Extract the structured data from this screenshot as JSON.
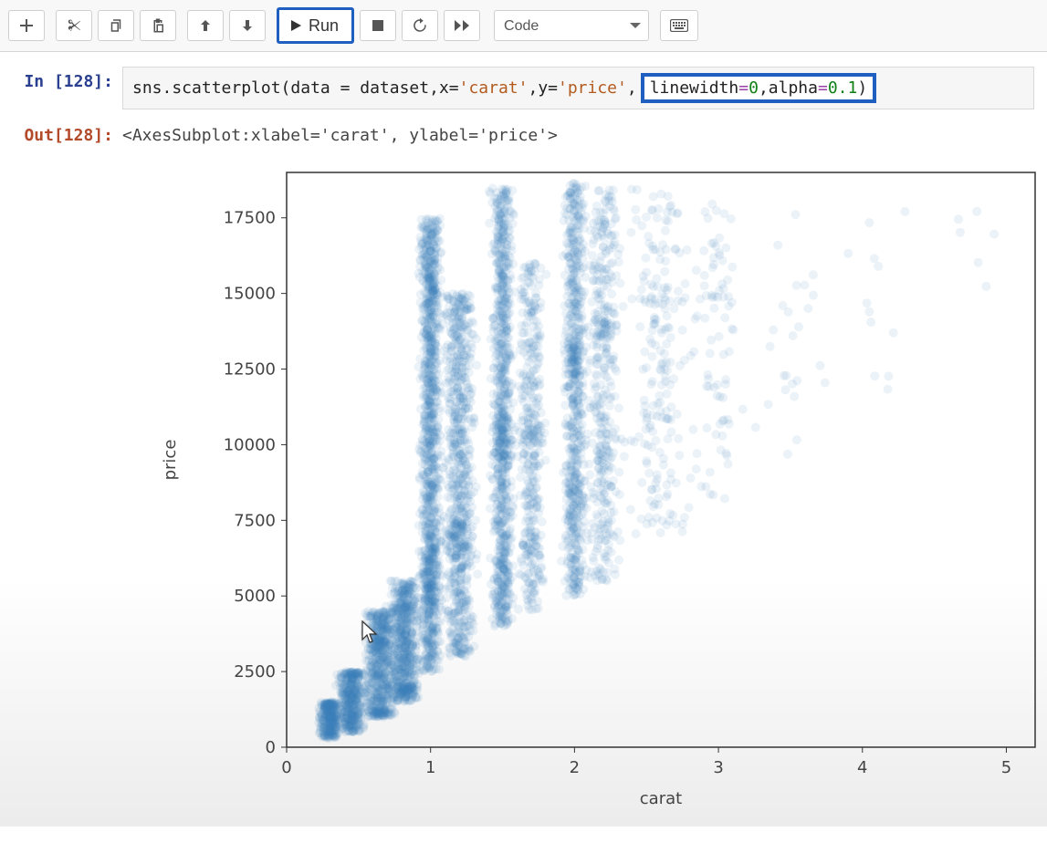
{
  "toolbar": {
    "run_label": "Run",
    "celltype_selected": "Code"
  },
  "cell": {
    "in_prompt": "In [128]:",
    "out_prompt": "Out[128]:",
    "code_prefix": "sns.scatterplot(data = dataset,x=",
    "code_str1": "'carat'",
    "code_mid": ",y=",
    "code_str2": "'price'",
    "code_highlight_pre": ",",
    "code_hl_kw1": "linewidth",
    "code_hl_eq": "=",
    "code_hl_num1": "0",
    "code_hl_comma": ",",
    "code_hl_kw2": "alpha",
    "code_hl_num2": "0.1",
    "code_hl_close": ")",
    "output_text": "<AxesSubplot:xlabel='carat', ylabel='price'>"
  },
  "chart_data": {
    "type": "scatter",
    "xlabel": "carat",
    "ylabel": "price",
    "xticks": [
      0,
      1,
      2,
      3,
      4,
      5
    ],
    "yticks": [
      0,
      2500,
      5000,
      7500,
      10000,
      12500,
      15000,
      17500
    ],
    "xlim": [
      0,
      5.2
    ],
    "ylim": [
      0,
      19000
    ],
    "alpha": 0.1,
    "color": "#3a7bbf",
    "density_bands": [
      {
        "x_center": 0.3,
        "x_spread": 0.1,
        "y_min": 300,
        "y_max": 1500,
        "n": 300
      },
      {
        "x_center": 0.45,
        "x_spread": 0.12,
        "y_min": 500,
        "y_max": 2500,
        "n": 400
      },
      {
        "x_center": 0.65,
        "x_spread": 0.14,
        "y_min": 1000,
        "y_max": 4500,
        "n": 600
      },
      {
        "x_center": 0.82,
        "x_spread": 0.14,
        "y_min": 1500,
        "y_max": 5500,
        "n": 600
      },
      {
        "x_center": 1.0,
        "x_spread": 0.1,
        "y_min": 2500,
        "y_max": 17500,
        "n": 1200
      },
      {
        "x_center": 1.2,
        "x_spread": 0.14,
        "y_min": 3000,
        "y_max": 15000,
        "n": 800
      },
      {
        "x_center": 1.5,
        "x_spread": 0.1,
        "y_min": 4000,
        "y_max": 18500,
        "n": 900
      },
      {
        "x_center": 1.7,
        "x_spread": 0.12,
        "y_min": 4500,
        "y_max": 16000,
        "n": 400
      },
      {
        "x_center": 2.0,
        "x_spread": 0.1,
        "y_min": 5000,
        "y_max": 18700,
        "n": 700
      },
      {
        "x_center": 2.2,
        "x_spread": 0.16,
        "y_min": 5500,
        "y_max": 18500,
        "n": 400
      },
      {
        "x_center": 2.6,
        "x_spread": 0.3,
        "y_min": 7000,
        "y_max": 18500,
        "n": 200
      },
      {
        "x_center": 3.0,
        "x_spread": 0.2,
        "y_min": 8000,
        "y_max": 18000,
        "n": 80
      },
      {
        "x_center": 3.5,
        "x_spread": 0.3,
        "y_min": 9000,
        "y_max": 18000,
        "n": 25
      },
      {
        "x_center": 4.1,
        "x_spread": 0.3,
        "y_min": 11000,
        "y_max": 18000,
        "n": 12
      },
      {
        "x_center": 4.8,
        "x_spread": 0.3,
        "y_min": 15000,
        "y_max": 18500,
        "n": 6
      }
    ]
  }
}
